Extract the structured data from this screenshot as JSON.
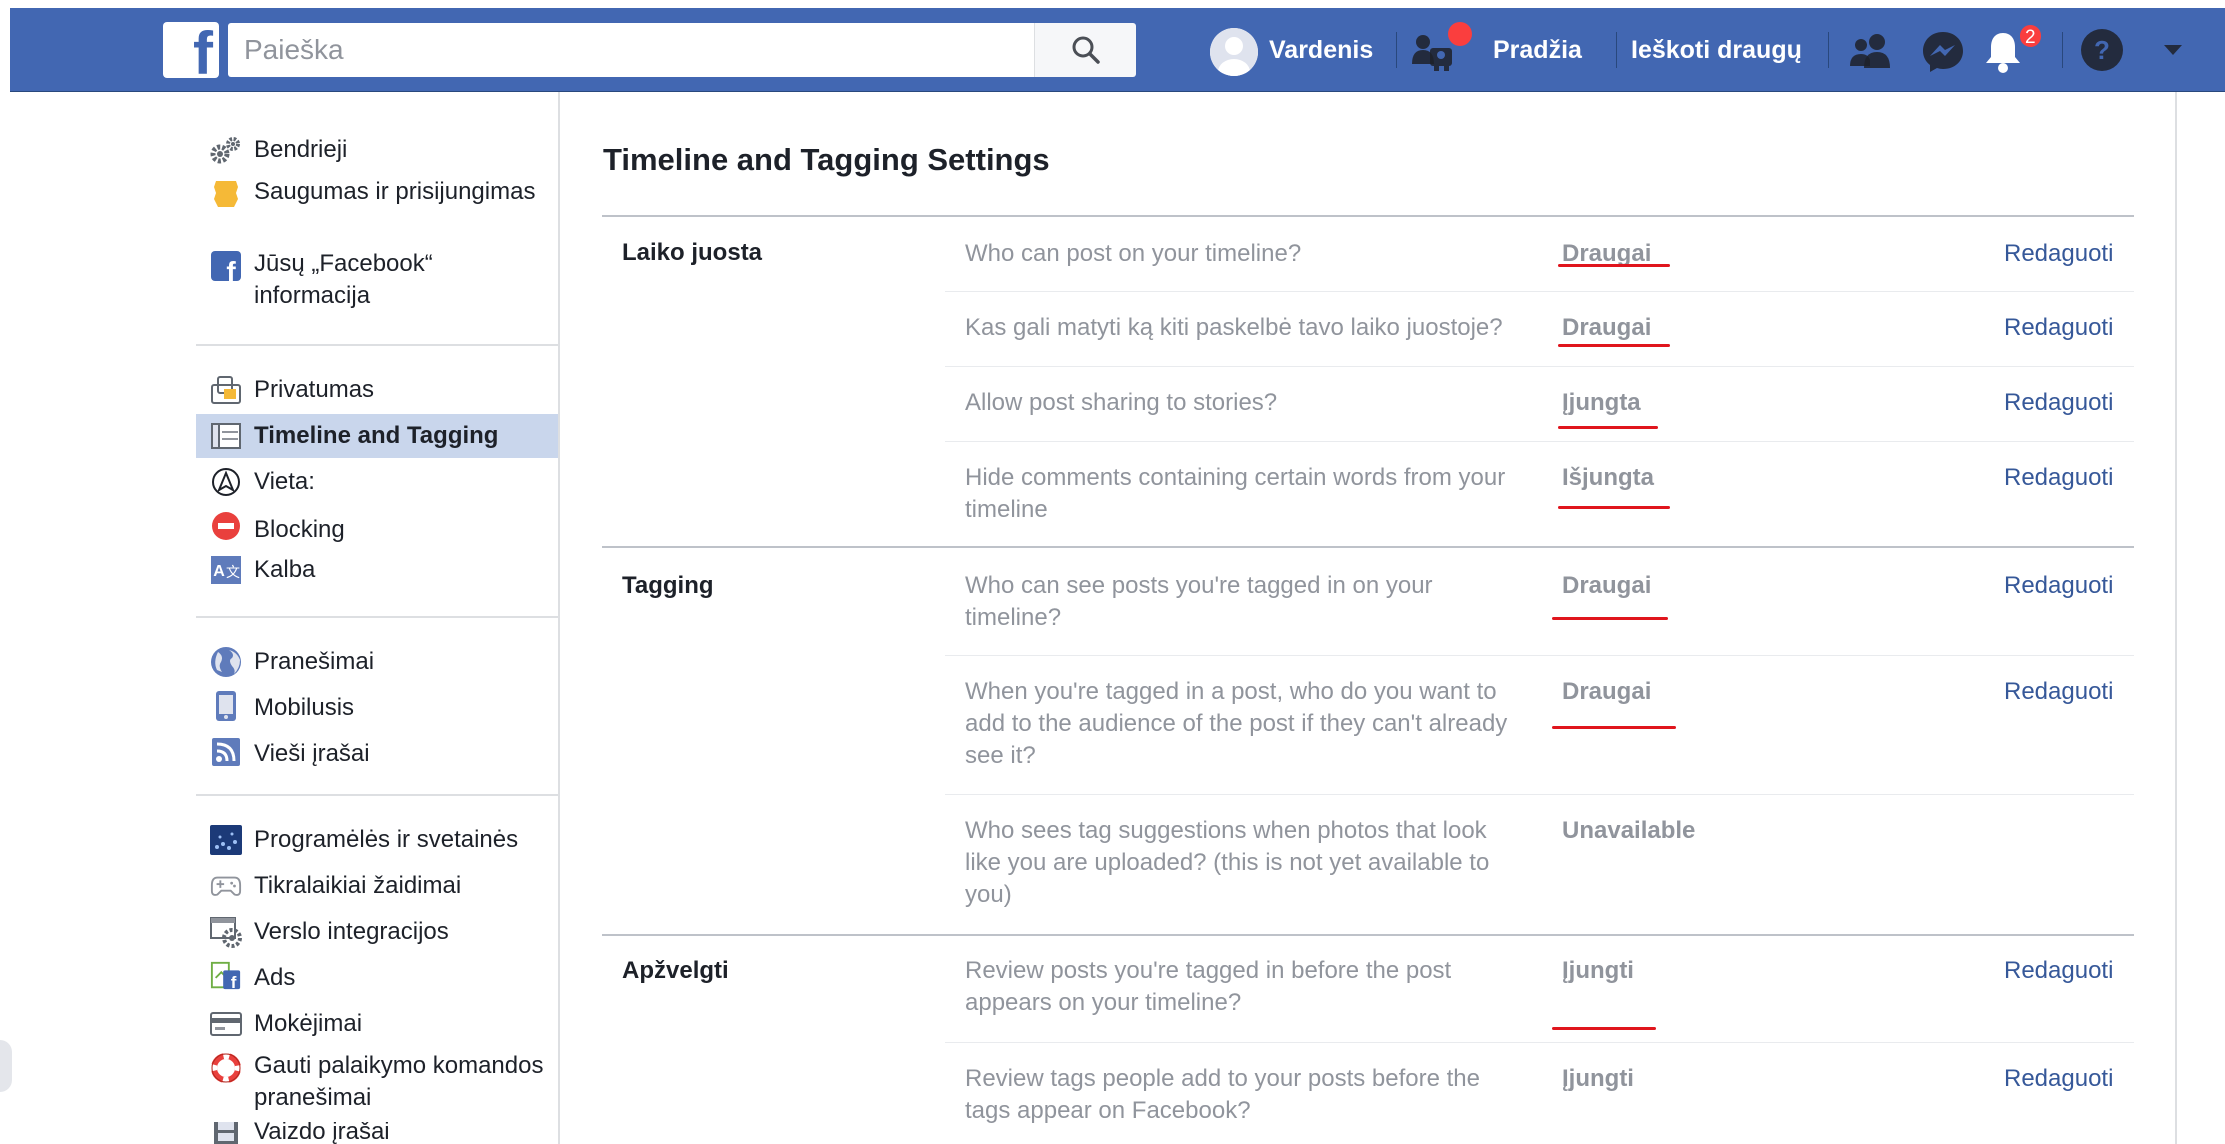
{
  "header": {
    "search_placeholder": "Paieška",
    "user_name": "Vardenis",
    "home_label": "Pradžia",
    "find_friends_label": "Ieškoti draugų",
    "notifications_count": "2",
    "brand_color": "#4267b2",
    "badge_color": "#fa3e3e"
  },
  "sidebar": {
    "groups": [
      {
        "items": [
          {
            "label": "Bendrieji",
            "icon": "gears-icon"
          },
          {
            "label": "Saugumas ir prisijungimas",
            "icon": "shield-badge-icon"
          },
          {
            "label": "Jūsų „Facebook“ informacija",
            "icon": "facebook-icon"
          }
        ]
      },
      {
        "items": [
          {
            "label": "Privatumas",
            "icon": "privacy-lock-icon"
          },
          {
            "label": "Timeline and Tagging",
            "icon": "timeline-icon",
            "active": true
          },
          {
            "label": "Vieta:",
            "icon": "location-icon"
          },
          {
            "label": "Blocking",
            "icon": "blocking-icon"
          },
          {
            "label": "Kalba",
            "icon": "language-icon"
          }
        ]
      },
      {
        "items": [
          {
            "label": "Pranešimai",
            "icon": "globe-icon"
          },
          {
            "label": "Mobilusis",
            "icon": "mobile-icon"
          },
          {
            "label": "Vieši įrašai",
            "icon": "rss-icon"
          }
        ]
      },
      {
        "items": [
          {
            "label": "Programėlės ir svetainės",
            "icon": "apps-icon"
          },
          {
            "label": "Tikralaikiai žaidimai",
            "icon": "gamepad-icon"
          },
          {
            "label": "Verslo integracijos",
            "icon": "business-gear-icon"
          },
          {
            "label": "Ads",
            "icon": "ads-icon"
          },
          {
            "label": "Mokėjimai",
            "icon": "payment-card-icon"
          },
          {
            "label": "Gauti palaikymo komandos pranešimai",
            "icon": "lifebuoy-icon"
          },
          {
            "label": "Vaizdo įrašai",
            "icon": "film-icon"
          }
        ]
      }
    ]
  },
  "main": {
    "title": "Timeline and Tagging Settings",
    "edit_label": "Redaguoti",
    "sections": [
      {
        "label": "Laiko juosta",
        "rows": [
          {
            "question": "Who can post on your timeline?",
            "value": "Draugai",
            "editable": true
          },
          {
            "question": "Kas gali matyti ką kiti paskelbė tavo laiko juostoje?",
            "value": "Draugai",
            "editable": true
          },
          {
            "question": "Allow post sharing to stories?",
            "value": "Įjungta",
            "editable": true
          },
          {
            "question": "Hide comments containing certain words from your timeline",
            "value": "Išjungta",
            "editable": true
          }
        ]
      },
      {
        "label": "Tagging",
        "rows": [
          {
            "question": "Who can see posts you're tagged in on your timeline?",
            "value": "Draugai",
            "editable": true
          },
          {
            "question": "When you're tagged in a post, who do you want to add to the audience of the post if they can't already see it?",
            "value": "Draugai",
            "editable": true
          },
          {
            "question": "Who sees tag suggestions when photos that look like you are uploaded? (this is not yet available to you)",
            "value": "Unavailable",
            "editable": false
          }
        ]
      },
      {
        "label": "Apžvelgti",
        "rows": [
          {
            "question": "Review posts you're tagged in before the post appears on your timeline?",
            "value": "Įjungti",
            "editable": true
          },
          {
            "question": "Review tags people add to your posts before the tags appear on Facebook?",
            "value": "Įjungti",
            "editable": true
          }
        ]
      }
    ],
    "annotation_color": "#e0151d"
  }
}
